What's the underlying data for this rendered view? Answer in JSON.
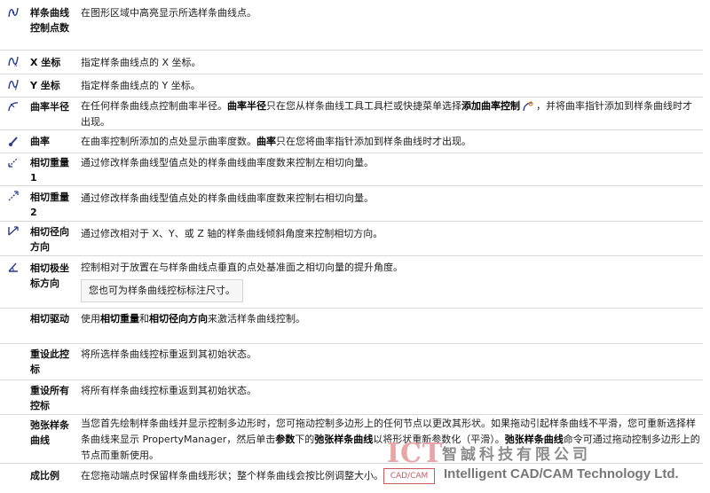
{
  "rows": [
    {
      "name": "样条曲线控制点数",
      "desc": "在图形区域中高亮显示所选样条曲线点。"
    },
    {
      "name": "X 坐标",
      "desc": "指定样条曲线点的 X 坐标。"
    },
    {
      "name": "Y 坐标",
      "desc": "指定样条曲线点的 Y 坐标。"
    },
    {
      "name": "曲率半径",
      "desc_parts": {
        "a": "在任何样条曲线点控制曲率半径。",
        "b": "曲率半径",
        "c": "只在您从样条曲线工具工具栏或快捷菜单选择",
        "d": "添加曲率控制",
        "e": "，并将曲率指针添加到样条曲线时才出现。"
      }
    },
    {
      "name": "曲率",
      "desc_parts": {
        "a": "在曲率控制所添加的点处显示曲率度数。",
        "b": "曲率",
        "c": "只在您将曲率指针添加到样条曲线时才出现。"
      }
    },
    {
      "name": "相切重量1",
      "desc": "通过修改样条曲线型值点处的样条曲线曲率度数来控制左相切向量。"
    },
    {
      "name": "相切重量 2",
      "desc": "通过修改样条曲线型值点处的样条曲线曲率度数来控制右相切向量。"
    },
    {
      "name": "相切径向方向",
      "desc": "通过修改相对于 X、Y、或 Z 轴的样条曲线倾斜角度来控制相切方向。"
    },
    {
      "name": "相切极坐标方向",
      "desc": "控制相对于放置在与样条曲线点垂直的点处基准面之相切向量的提升角度。",
      "note": "您也可为样条曲线控标标注尺寸。"
    },
    {
      "name": "相切驱动",
      "desc_parts": {
        "a": "使用",
        "b": "相切重量",
        "c": "和",
        "d": "相切径向方向",
        "e": "来激活样条曲线控制。"
      }
    },
    {
      "name": "重设此控标",
      "desc": "将所选样条曲线控标重返到其初始状态。"
    },
    {
      "name": "重设所有控标",
      "desc": "将所有样条曲线控标重返到其初始状态。"
    },
    {
      "name": "弛张样条曲线",
      "desc_parts": {
        "a": "当您首先绘制样条曲线并显示控制多边形时，您可拖动控制多边形上的任何节点以更改其形状。如果拖动引起样条曲线不平滑，您可重新选择样条曲线来显示 PropertyManager，然后单击",
        "b": "参数",
        "c": "下的",
        "d": "弛张样条曲线",
        "e": "以将形状重新参数化（平滑）。",
        "f": "弛张样条曲线",
        "g": "命令可通过拖动控制多边形上的节点而重新使用。"
      }
    },
    {
      "name": "成比例",
      "desc": "在您拖动端点时保留样条曲线形状；整个样条曲线会按比例调整大小。"
    }
  ],
  "watermark": {
    "logo": "ICT",
    "badge": "CAD/CAM",
    "chinese": "智誠科技有限公司",
    "english": "Intelligent CAD/CAM Technology Ltd."
  },
  "colors": {
    "row_border": "#d8d8d8",
    "icon_blue": "#2a3c8e",
    "watermark_red": "#c85a60"
  }
}
